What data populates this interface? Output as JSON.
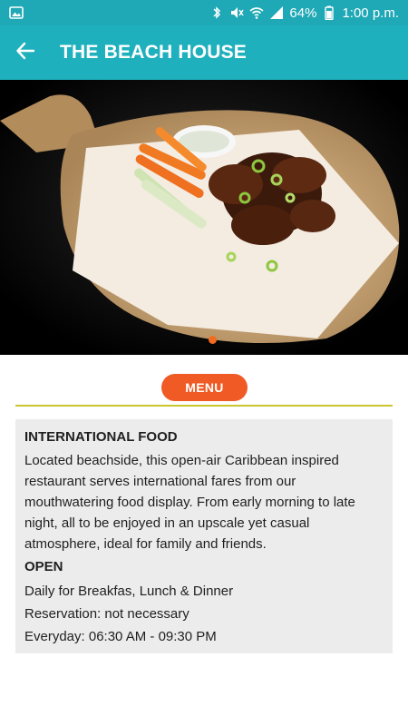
{
  "status_bar": {
    "battery": "64%",
    "time": "1:00 p.m."
  },
  "app_bar": {
    "title": "THE BEACH HOUSE"
  },
  "carousel": {
    "page_count": 1,
    "active_index": 0,
    "active_dot_color": "#f36b21"
  },
  "menu_button": {
    "label": "MENU"
  },
  "info": {
    "heading": "INTERNATIONAL FOOD",
    "description": "Located beachside, this open-air Caribbean inspired restaurant serves international fares from our mouthwatering food display. From early morning to late night, all to be enjoyed in an upscale yet casual atmosphere, ideal for family and friends.",
    "open_heading": "OPEN",
    "schedule": "Daily for Breakfas, Lunch & Dinner",
    "reservation": "Reservation: not necessary",
    "hours": "Everyday: 06:30 AM - 09:30 PM"
  },
  "colors": {
    "primary": "#1fb0bd",
    "status_bar": "#1fa8b5",
    "accent": "#f05a24",
    "divider": "#c9c62e",
    "card_bg": "#ececec"
  }
}
